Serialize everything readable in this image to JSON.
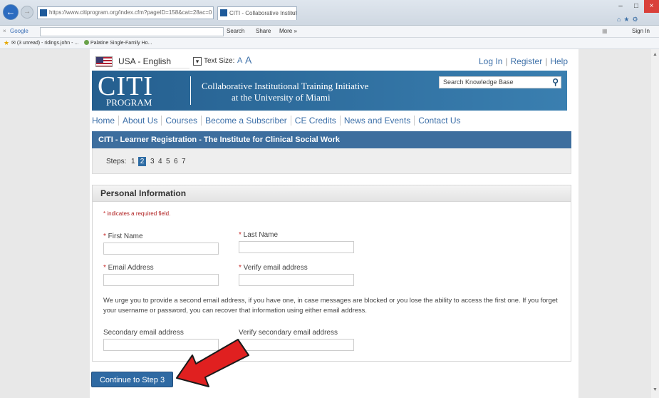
{
  "browser": {
    "address": "https://www.citiprogram.org/index.cfm?pageID=158&cat=28ac=0",
    "tab_title": "CITI - Collaborative Instituti...",
    "toolbar": {
      "google_label": "Google",
      "search_label": "Search",
      "share_label": "Share",
      "more_label": "More »",
      "signin_label": "Sign In"
    },
    "favorites": {
      "mail_label": "(3 unread) - ridings.john - ...",
      "item2_label": "Palatine Single-Family Ho..."
    }
  },
  "header": {
    "language": "USA - English",
    "text_size_label": "Text Size:",
    "text_size_small": "A",
    "text_size_large": "A",
    "links": {
      "login": "Log In",
      "register": "Register",
      "help": "Help"
    }
  },
  "banner": {
    "logo_main": "CITI",
    "logo_sub": "PROGRAM",
    "title_line1": "Collaborative Institutional Training Initiative",
    "title_line2": "at the University of Miami",
    "search_placeholder": "Search Knowledge Base"
  },
  "nav": {
    "items": [
      "Home",
      "About Us",
      "Courses",
      "Become a Subscriber",
      "CE Credits",
      "News and Events",
      "Contact Us"
    ]
  },
  "registration": {
    "title": "CITI - Learner Registration - The Institute for Clinical Social Work",
    "steps_label": "Steps:",
    "steps": [
      "1",
      "2",
      "3",
      "4",
      "5",
      "6",
      "7"
    ],
    "current_step": "2"
  },
  "personal_info": {
    "heading": "Personal Information",
    "required_note": "indicates a required field.",
    "first_name_label": "First Name",
    "last_name_label": "Last Name",
    "email_label": "Email Address",
    "verify_email_label": "Verify email address",
    "notice": "We urge you to provide a second email address, if you have one, in case messages are blocked or you lose the ability to access the first one. If you forget your username or password, you can recover that information using either email address.",
    "secondary_email_label": "Secondary email address",
    "verify_secondary_label": "Verify secondary email address",
    "first_name_value": "",
    "last_name_value": "",
    "email_value": "",
    "verify_email_value": "",
    "secondary_email_value": "",
    "verify_secondary_value": ""
  },
  "actions": {
    "continue_label": "Continue to Step 3"
  },
  "colors": {
    "brand_blue": "#2f6aa3",
    "arrow_red": "#e02020",
    "link_blue": "#3c6fa8"
  },
  "icons": {
    "back": "arrow-left-icon",
    "search": "magnifier-icon",
    "annotation": "red-arrow-icon"
  }
}
